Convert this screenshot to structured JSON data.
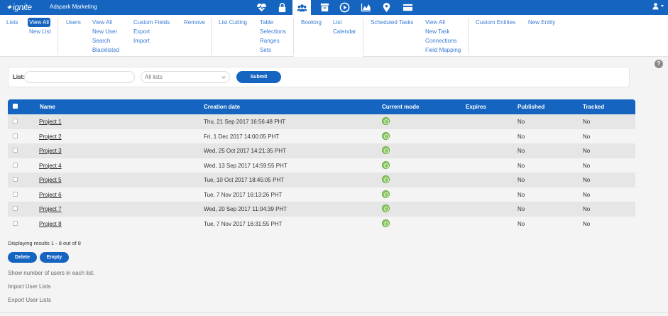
{
  "header": {
    "logo": "ignite",
    "company": "Adspark Marketing",
    "icons": [
      "heartbeat-icon",
      "lock-icon",
      "users-icon",
      "archive-icon",
      "play-icon",
      "chart-icon",
      "map-pin-icon",
      "card-icon"
    ],
    "active_icon": "users-icon"
  },
  "submenu": {
    "lists": "Lists",
    "view_all": "View All",
    "new_list": "New List",
    "users": "Users",
    "users_view_all": "View All",
    "new_user": "New User",
    "search": "Search",
    "blacklisted": "Blacklisted",
    "custom_fields": "Custom Fields",
    "export": "Export",
    "import": "Import",
    "remove": "Remove",
    "list_cutting": "List Cutting",
    "table": "Table",
    "selections": "Selections",
    "ranges": "Ranges",
    "sets": "Sets",
    "booking": "Booking",
    "list": "List",
    "calendar": "Calendar",
    "scheduled_tasks": "Scheduled Tasks",
    "tasks_view_all": "View All",
    "new_task": "New Task",
    "connections": "Connections",
    "field_mapping": "Field Mapping",
    "custom_entities": "Custom Entities",
    "new_entity": "New Entity"
  },
  "filter": {
    "label": "List:",
    "input_value": "",
    "select_value": "All lists",
    "submit": "Submit"
  },
  "help": "?",
  "table": {
    "headers": {
      "name": "Name",
      "creation_date": "Creation date",
      "current_mode": "Current mode",
      "expires": "Expires",
      "published": "Published",
      "tracked": "Tracked"
    },
    "rows": [
      {
        "name": "Project 1",
        "date": "Thu, 21 Sep 2017 16:56:48 PHT",
        "expires": "",
        "published": "No",
        "tracked": "No"
      },
      {
        "name": "Project 2",
        "date": "Fri, 1 Dec 2017 14:00:05 PHT",
        "expires": "",
        "published": "No",
        "tracked": "No"
      },
      {
        "name": "Project 3",
        "date": "Wed, 25 Oct 2017 14:21:35 PHT",
        "expires": "",
        "published": "No",
        "tracked": "No"
      },
      {
        "name": "Project 4",
        "date": "Wed, 13 Sep 2017 14:59:55 PHT",
        "expires": "",
        "published": "No",
        "tracked": "No"
      },
      {
        "name": "Project 5",
        "date": "Tue, 10 Oct 2017 18:45:05 PHT",
        "expires": "",
        "published": "No",
        "tracked": "No"
      },
      {
        "name": "Project 6",
        "date": "Tue, 7 Nov 2017 16:13:26 PHT",
        "expires": "",
        "published": "No",
        "tracked": "No"
      },
      {
        "name": "Project 7",
        "date": "Wed, 20 Sep 2017 11:04:39 PHT",
        "expires": "",
        "published": "No",
        "tracked": "No"
      },
      {
        "name": "Project 8",
        "date": "Tue, 7 Nov 2017 16:31:55 PHT",
        "expires": "",
        "published": "No",
        "tracked": "No"
      }
    ]
  },
  "results_text": "Displaying results 1 - 8 out of 8",
  "actions": {
    "delete": "Delete",
    "empty": "Empty"
  },
  "footer_links": {
    "show_users": "Show number of users in each list.",
    "import_lists": "Import User Lists",
    "export_lists": "Export User Lists"
  },
  "colors": {
    "primary": "#1565c0",
    "link": "#3a7bd5",
    "mode_active": "#8fc866"
  }
}
